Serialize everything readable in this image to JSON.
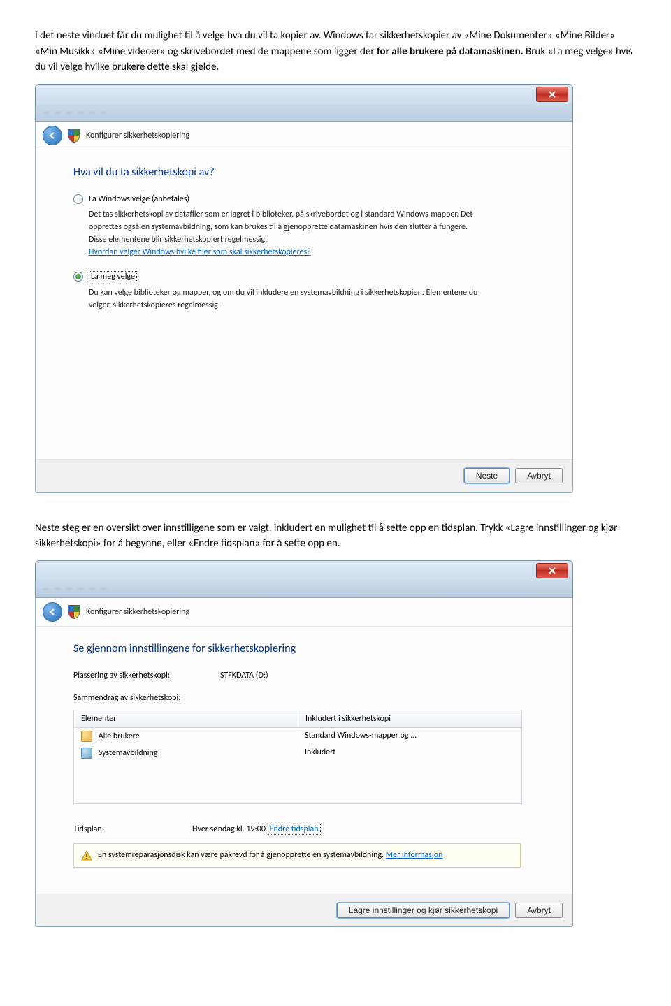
{
  "intro": {
    "p1a": "I det neste vinduet får du mulighet til å velge hva du vil ta kopier av. Windows tar sikkerhetskopier av «Mine Dokumenter» «Mine Bilder» «Min Musikk» «Mine videoer» og skrivebordet med de mappene som ligger der ",
    "p1b": "for alle brukere på datamaskinen.",
    "p1c": " Bruk «La meg velge» hvis du vil velge hvilke brukere dette skal gjelde."
  },
  "dialog1": {
    "close_x": "✕",
    "nav_title": "Konfigurer sikkerhetskopiering",
    "heading": "Hva vil du ta sikkerhetskopi av?",
    "opt1_label": "La Windows velge (anbefales)",
    "opt1_desc_a": "Det tas sikkerhetskopi av datafiler som er lagret i biblioteker, på skrivebordet og i standard Windows-mapper. Det opprettes også en systemavbildning, som kan brukes til å gjenopprette datamaskinen hvis den slutter å fungere. Disse elementene blir sikkerhetskopiert regelmessig.",
    "opt1_link": "Hvordan velger Windows hvilke filer som skal sikkerhetskopieres?",
    "opt2_label": "La meg velge",
    "opt2_desc": "Du kan velge biblioteker og mapper, og om du vil inkludere en systemavbildning i sikkerhetskopien. Elementene du velger, sikkerhetskopieres regelmessig.",
    "btn_next": "Neste",
    "btn_cancel": "Avbryt"
  },
  "mid": {
    "text": "Neste steg er en oversikt over innstilligene som er valgt, inkludert en mulighet til å sette opp en tidsplan. Trykk «Lagre innstillinger og kjør sikkerhetskopi» for å begynne, eller «Endre tidsplan» for å sette opp en."
  },
  "dialog2": {
    "nav_title": "Konfigurer sikkerhetskopiering",
    "heading": "Se gjennom innstillingene for sikkerhetskopiering",
    "loc_key": "Plassering av sikkerhetskopi:",
    "loc_val": "STFKDATA (D:)",
    "sum_label": "Sammendrag av sikkerhetskopi:",
    "col_elements": "Elementer",
    "col_included": "Inkludert i sikkerhetskopi",
    "rows": [
      {
        "name": "Alle brukere",
        "included": "Standard Windows-mapper og ..."
      },
      {
        "name": "Systemavbildning",
        "included": "Inkludert"
      }
    ],
    "sched_key": "Tidsplan:",
    "sched_val": "Hver søndag kl. 19:00 ",
    "sched_link": "Endre tidsplan",
    "warn_text": "En systemreparasjonsdisk kan være påkrevd for å gjenopprette en systemavbildning. ",
    "warn_link": "Mer informasjon",
    "btn_save": "Lagre innstillinger og kjør sikkerhetskopi",
    "btn_cancel": "Avbryt"
  }
}
